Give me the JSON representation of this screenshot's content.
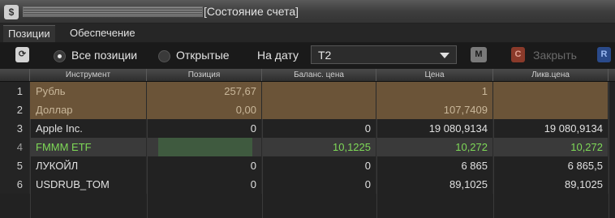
{
  "window": {
    "title": "[Состояние счета]",
    "icon": "money-icon"
  },
  "tabs": [
    {
      "label": "Позиции",
      "active": true
    },
    {
      "label": "Обеспечение",
      "active": false
    }
  ],
  "toolbar": {
    "refresh_icon": "refresh-icon",
    "radio_all": "Все позиции",
    "radio_open": "Открытые",
    "selected_radio": "Все позиции",
    "date_label": "На дату",
    "date_value": "T2",
    "m_button": "M",
    "close_icon_letter": "C",
    "close_label": "Закрыть",
    "r_button": "R"
  },
  "table": {
    "columns": [
      "Инструмент",
      "Позиция",
      "Баланс. цена",
      "Цена",
      "Ликв.цена"
    ],
    "rows": [
      {
        "n": "1",
        "instrument": "Рубль",
        "position": "257,67",
        "balance_price": "",
        "price": "1",
        "liq_price": "",
        "style": "highlight"
      },
      {
        "n": "2",
        "instrument": "Доллар",
        "position": "0,00",
        "balance_price": "",
        "price": "107,7409",
        "liq_price": "",
        "style": "highlight"
      },
      {
        "n": "3",
        "instrument": "Apple Inc.",
        "position": "0",
        "balance_price": "0",
        "price": "19 080,9134",
        "liq_price": "19 080,9134",
        "style": "normal"
      },
      {
        "n": "4",
        "instrument": "FMMM ETF",
        "position": "",
        "balance_price": "10,1225",
        "price": "10,272",
        "liq_price": "10,272",
        "style": "selected"
      },
      {
        "n": "5",
        "instrument": "ЛУКОЙЛ",
        "position": "0",
        "balance_price": "0",
        "price": "6 865",
        "liq_price": "6 865,5",
        "style": "normal"
      },
      {
        "n": "6",
        "instrument": "USDRUB_TOM",
        "position": "0",
        "balance_price": "0",
        "price": "89,1025",
        "liq_price": "89,1025",
        "style": "normal"
      }
    ]
  },
  "colors": {
    "highlight_row": "#6b5438",
    "selected_row": "#3a3a3a",
    "selected_text": "#7ed957",
    "highlight_text": "#c9b79a",
    "normal_text": "#e0e0e0"
  }
}
